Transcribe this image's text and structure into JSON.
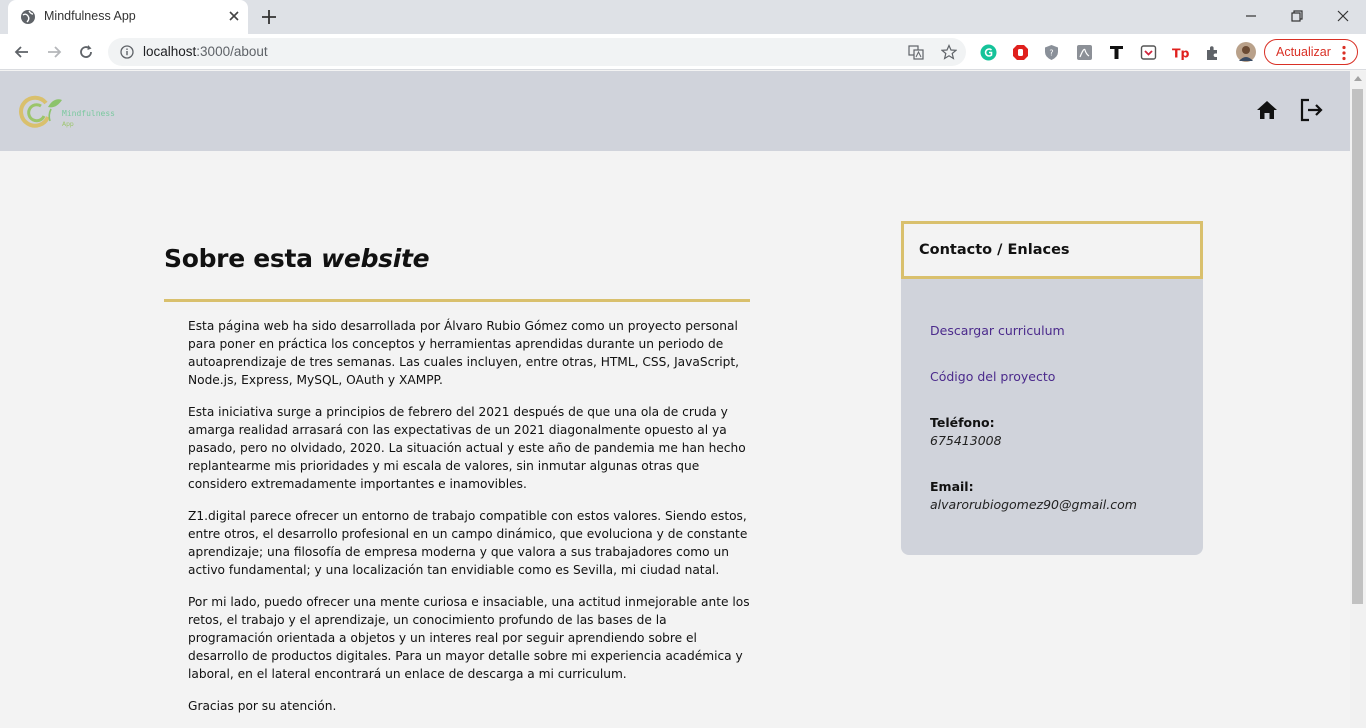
{
  "browser": {
    "tab_title": "Mindfulness App",
    "url_host": "localhost",
    "url_path": ":3000/about",
    "update_label": "Actualizar"
  },
  "header": {
    "logo_text": "Mindfulness",
    "logo_subtext": "App"
  },
  "about": {
    "title_plain": "Sobre esta ",
    "title_emphasis": "website",
    "paragraphs": [
      "Esta página web ha sido desarrollada por Álvaro Rubio Gómez como un proyecto personal para poner en práctica los conceptos y herramientas aprendidas durante un periodo de autoaprendizaje de tres semanas. Las cuales incluyen, entre otras, HTML, CSS, JavaScript, Node.js, Express, MySQL, OAuth y XAMPP.",
      "Esta iniciativa surge a principios de febrero del 2021 después de que una ola de cruda y amarga realidad arrasará con las expectativas de un 2021 diagonalmente opuesto al ya pasado, pero no olvidado, 2020. La situación actual y este año de pandemia me han hecho replantearme mis prioridades y mi escala de valores, sin inmutar algunas otras que considero extremadamente importantes e inamovibles.",
      "Z1.digital parece ofrecer un entorno de trabajo compatible con estos valores. Siendo estos, entre otros, el desarrollo profesional en un campo dinámico, que evoluciona y de constante aprendizaje; una filosofía de empresa moderna y que valora a sus trabajadores como un activo fundamental; y una localización tan envidiable como es Sevilla, mi ciudad natal.",
      "Por mi lado, puedo ofrecer una mente curiosa e insaciable, una actitud inmejorable ante los retos, el trabajo y el aprendizaje, un conocimiento profundo de las bases de la programación orientada a objetos y un interes real por seguir aprendiendo sobre el desarrollo de productos digitales. Para un mayor detalle sobre mi experiencia académica y laboral, en el lateral encontrará un enlace de descarga a mi curriculum.",
      "Gracias por su atención."
    ]
  },
  "contact": {
    "title": "Contacto / Enlaces",
    "download_cv": "Descargar curriculum",
    "project_code": "Código del proyecto",
    "phone_label": "Teléfono:",
    "phone_value": "675413008",
    "email_label": "Email:",
    "email_value": "alvarorubiogomez90@gmail.com"
  },
  "colors": {
    "accent_gold": "#d9c06d",
    "header_gray": "#d0d3db",
    "link_purple": "#4b2a8c"
  }
}
